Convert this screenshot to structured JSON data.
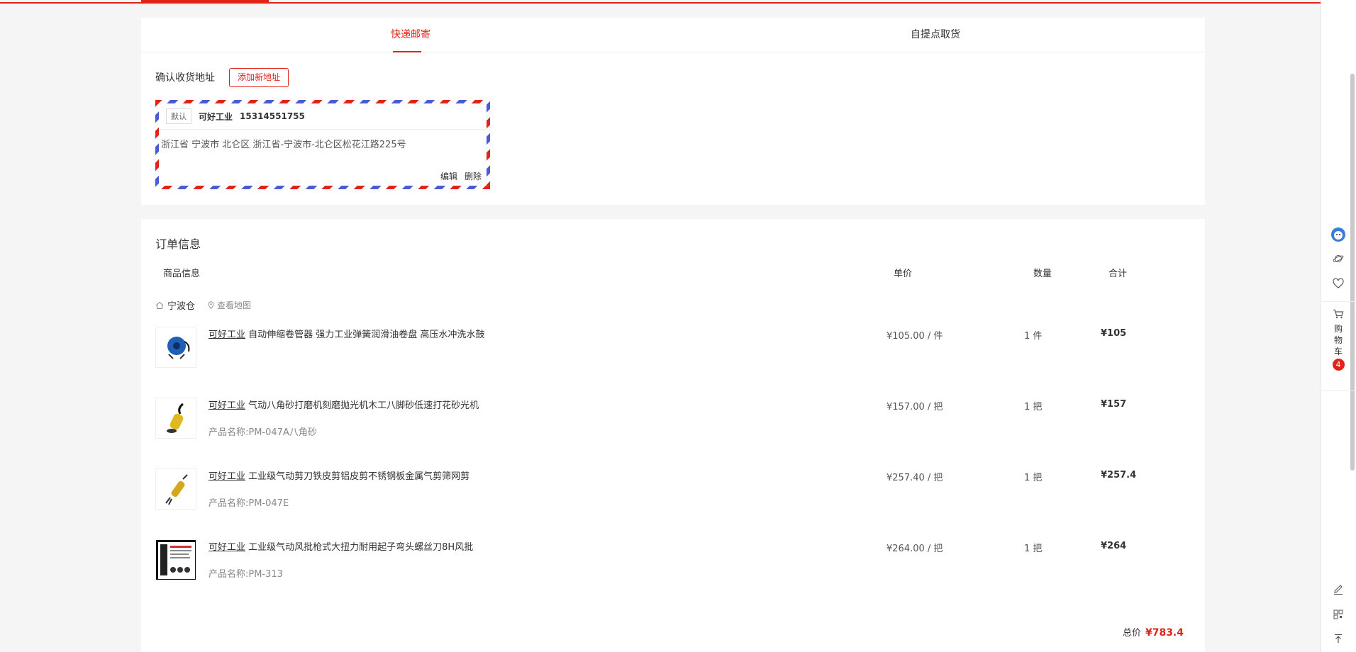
{
  "colors": {
    "accent": "#e2231a",
    "stripe_blue": "#4a5bd8"
  },
  "shipping": {
    "tabs": [
      {
        "label": "快递邮寄"
      },
      {
        "label": "自提点取货"
      }
    ],
    "address_label": "确认收货地址",
    "add_address_button": "添加新地址",
    "address": {
      "default_badge": "默认",
      "name": "可好工业",
      "phone": "15314551755",
      "detail": "浙江省 宁波市 北仑区 浙江省-宁波市-北仑区松花江路225号",
      "edit": "编辑",
      "delete": "删除"
    }
  },
  "order": {
    "title": "订单信息",
    "columns": {
      "product": "商品信息",
      "price": "单价",
      "qty": "数量",
      "total": "合计"
    },
    "warehouse": "宁波仓",
    "view_map": "查看地图",
    "items": [
      {
        "brand": "可好工业",
        "name": " 自动伸缩卷管器 强力工业弹簧润滑油卷盘 高压水冲洗水鼓",
        "sub": "",
        "price": "¥105.00 / 件",
        "qty": "1 件",
        "total": "¥105",
        "icon": "hose-reel-icon"
      },
      {
        "brand": "可好工业",
        "name": " 气动八角砂打磨机刻磨抛光机木工八脚砂低速打花砂光机",
        "sub": "产品名称:PM-047A八角砂",
        "price": "¥157.00 / 把",
        "qty": "1 把",
        "total": "¥157",
        "icon": "air-sander-icon"
      },
      {
        "brand": "可好工业",
        "name": " 工业级气动剪刀铁皮剪铝皮剪不锈钢板金属气剪筛网剪",
        "sub": "产品名称:PM-047E",
        "price": "¥257.40 / 把",
        "qty": "1 把",
        "total": "¥257.4",
        "icon": "air-shear-icon"
      },
      {
        "brand": "可好工业",
        "name": " 工业级气动风批枪式大扭力耐用起子弯头螺丝刀8H风批",
        "sub": "产品名称:PM-313",
        "price": "¥264.00 / 把",
        "qty": "1 把",
        "total": "¥264",
        "icon": "screwdriver-kit-icon"
      }
    ],
    "total_label": "总价",
    "total_value": "¥783.4"
  },
  "sidebar": {
    "cart_label": "购物车",
    "cart_count": "4"
  }
}
